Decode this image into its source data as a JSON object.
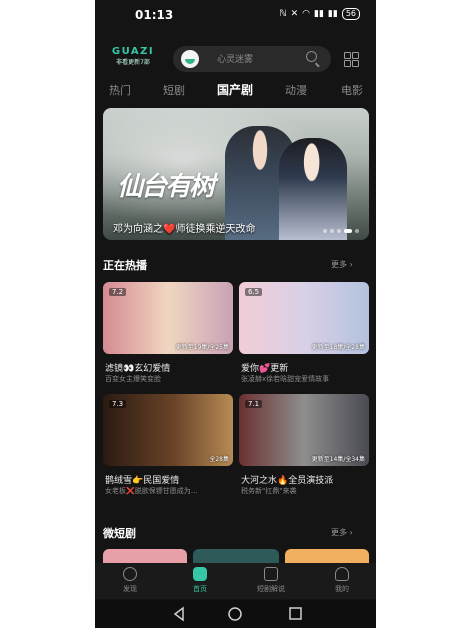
{
  "status_bar": {
    "time": "01:13",
    "battery": "56"
  },
  "header": {
    "logo_title": "GUAZI",
    "logo_subtitle": "非看更新7部",
    "search_placeholder": "心灵迷雾"
  },
  "tabs": [
    {
      "label": "热门"
    },
    {
      "label": "短剧"
    },
    {
      "label": "国产剧"
    },
    {
      "label": "动漫"
    },
    {
      "label": "电影"
    }
  ],
  "active_tab": "国产剧",
  "banner": {
    "title_art": "仙台有树",
    "caption": "邓为向涵之❤️师徒换乘逆天改命"
  },
  "now_playing": {
    "title": "正在热播",
    "more": "更多 ›",
    "cards": [
      {
        "rating": "7.2",
        "episodes": "更新至19集/全25集",
        "title": "滤镜👀玄幻爱情",
        "subtitle": "百变女主爆笑变脸",
        "colors": [
          "#c96f7a",
          "#e8c7a8"
        ]
      },
      {
        "rating": "6.5",
        "episodes": "更新至18集/全28集",
        "title": "爱你💕更新",
        "subtitle": "张凌赫x徐若晗甜宠爱情故事",
        "colors": [
          "#e7bcc8",
          "#a8b7d8"
        ]
      },
      {
        "rating": "7.3",
        "episodes": "全28集",
        "title": "鹊绒雪👉民国爱情",
        "subtitle": "女老板❌脱欲保镖甘愿成为…",
        "colors": [
          "#3a2418",
          "#a87a4a"
        ]
      },
      {
        "rating": "7.1",
        "episodes": "更新至14集/全34集",
        "title": "大河之水🔥全员演技派",
        "subtitle": "税务新\"扛鼎\"来袭",
        "colors": [
          "#5b2a2a",
          "#c8c8c8"
        ]
      }
    ]
  },
  "micro_drama": {
    "title": "微短剧",
    "more": "更多 ›"
  },
  "bottom_nav": [
    {
      "label": "发现"
    },
    {
      "label": "首页"
    },
    {
      "label": "短剧解说"
    },
    {
      "label": "我的"
    }
  ]
}
